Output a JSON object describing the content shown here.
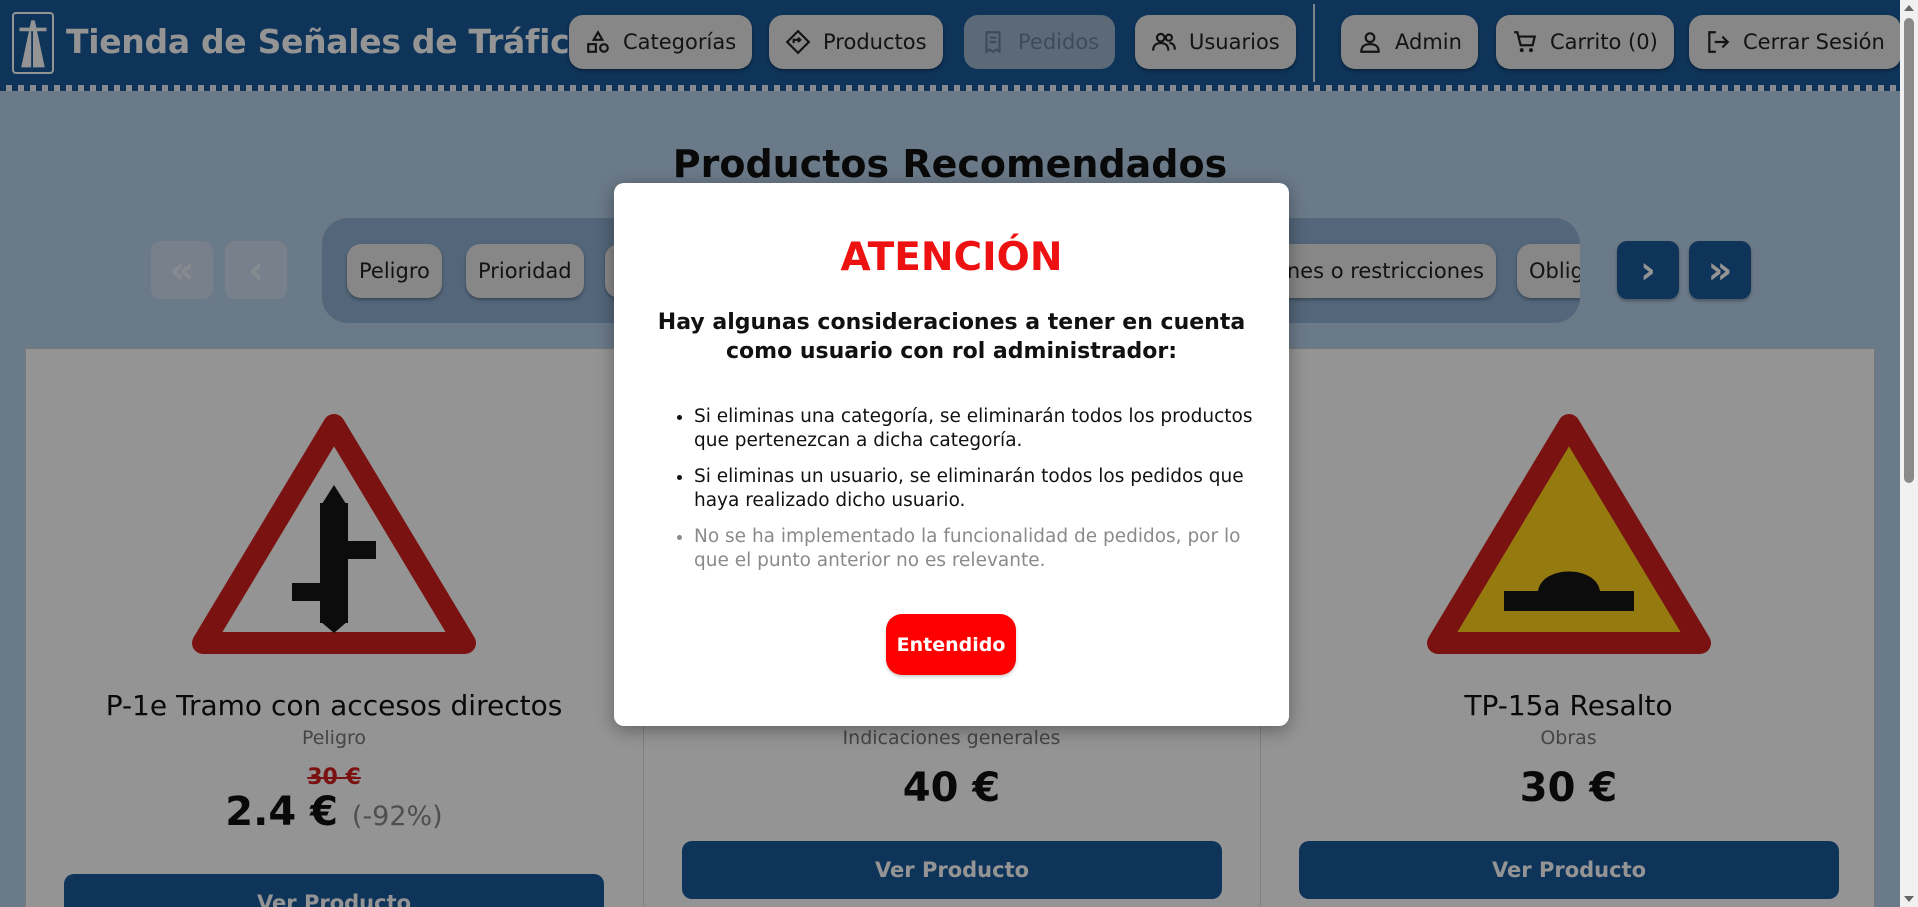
{
  "header": {
    "title": "Tienda de Señales de Tráfico",
    "nav": {
      "categorias": "Categorías",
      "productos": "Productos",
      "pedidos": "Pedidos",
      "usuarios": "Usuarios",
      "admin": "Admin",
      "carrito": "Carrito (0)",
      "cerrar_sesion": "Cerrar Sesión"
    }
  },
  "main": {
    "title": "Productos Recomendados",
    "categories": [
      "Peligro",
      "Prioridad",
      "ones o restricciones",
      "Oblig"
    ],
    "arrows": {
      "first": "«",
      "prev": "‹",
      "next": "›",
      "last": "»"
    },
    "products": [
      {
        "name": "P-1e Tramo con accesos directos",
        "category": "Peligro",
        "old_price": "30 €",
        "price": "2.4 €",
        "discount": "(-92%)",
        "button": "Ver Producto"
      },
      {
        "name": "",
        "category": "Indicaciones generales",
        "price": "40 €",
        "button": "Ver Producto"
      },
      {
        "name": "TP-15a Resalto",
        "category": "Obras",
        "price": "30 €",
        "button": "Ver Producto"
      }
    ]
  },
  "modal": {
    "title": "ATENCIÓN",
    "subtitle": "Hay algunas consideraciones a tener en cuenta como usuario con rol administrador:",
    "items": [
      "Si eliminas una categoría, se eliminarán todos los productos que pertenezcan a dicha categoría.",
      "Si eliminas un usuario, se eliminarán todos los pedidos que haya realizado dicho usuario.",
      "No se ha implementado la funcionalidad de pedidos, por lo que el punto anterior no es relevante."
    ],
    "button": "Entendido"
  },
  "colors": {
    "header_bg": "#1a5a9a",
    "accent_red": "#ff0000",
    "sign_red": "#d52020",
    "sign_yellow": "#ffd21a",
    "page_bg": "#b9d3ec"
  },
  "icons": [
    "shapes-icon",
    "diamond-arrow-icon",
    "receipt-icon",
    "users-icon",
    "user-icon",
    "cart-icon",
    "logout-icon"
  ]
}
